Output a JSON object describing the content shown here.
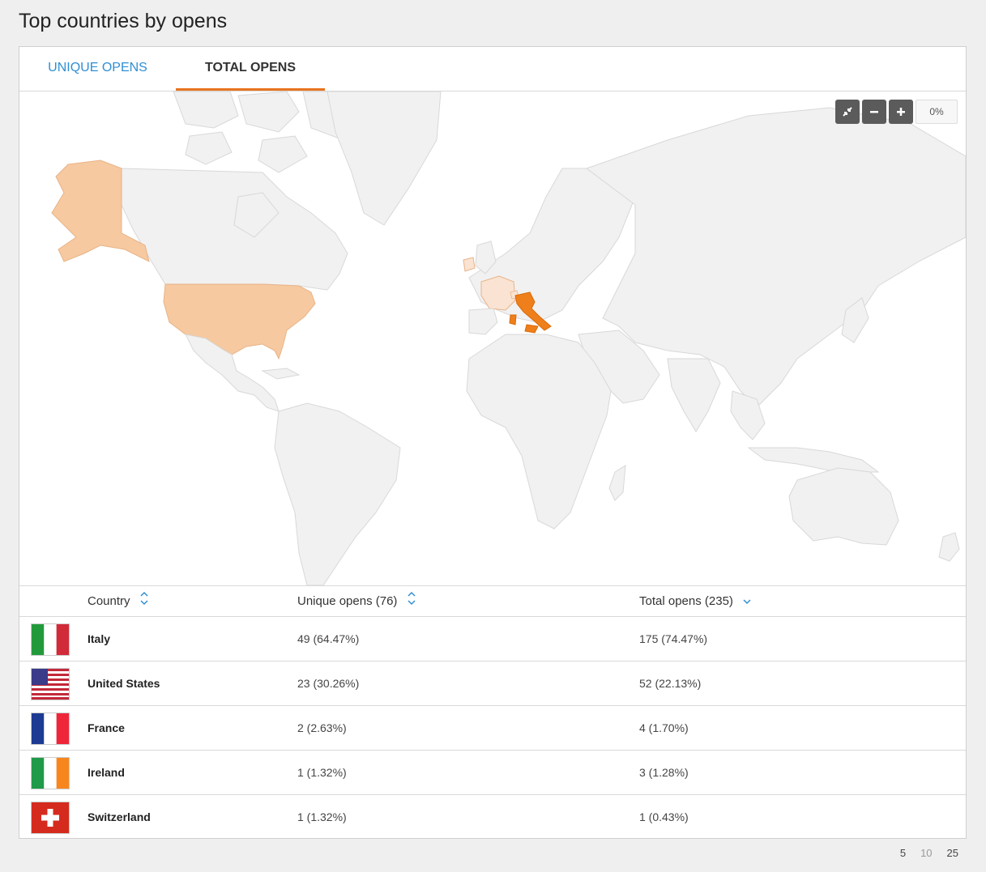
{
  "page": {
    "title": "Top countries by opens"
  },
  "tabs": [
    {
      "label": "UNIQUE OPENS",
      "active": false
    },
    {
      "label": "TOTAL OPENS",
      "active": true
    }
  ],
  "map": {
    "zoom_label": "0%",
    "highlight_colors": {
      "high": "#ef7f1a",
      "medium": "#f6c9a0",
      "low": "#fae3d3",
      "empty": "#f1f1f1"
    }
  },
  "table": {
    "headers": {
      "country": "Country",
      "unique": "Unique opens (76)",
      "total": "Total opens (235)"
    },
    "rows": [
      {
        "country": "Italy",
        "unique": "49 (64.47%)",
        "total": "175 (74.47%)",
        "flag": "italy-flag"
      },
      {
        "country": "United States",
        "unique": "23 (30.26%)",
        "total": "52 (22.13%)",
        "flag": "us-flag"
      },
      {
        "country": "France",
        "unique": "2 (2.63%)",
        "total": "4 (1.70%)",
        "flag": "france-flag"
      },
      {
        "country": "Ireland",
        "unique": "1 (1.32%)",
        "total": "3 (1.28%)",
        "flag": "ireland-flag"
      },
      {
        "country": "Switzerland",
        "unique": "1 (1.32%)",
        "total": "1 (0.43%)",
        "flag": "switzerland-flag"
      }
    ]
  },
  "pager": {
    "sizes": [
      "5",
      "10",
      "25"
    ]
  }
}
